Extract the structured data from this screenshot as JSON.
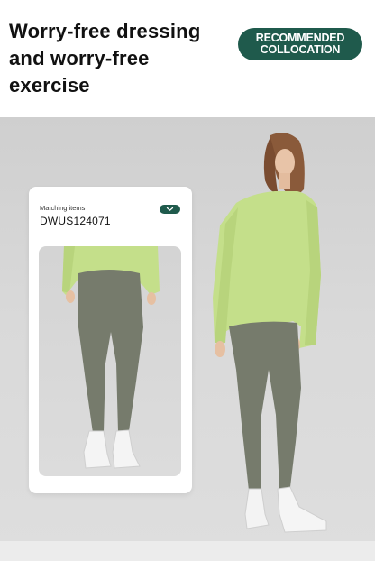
{
  "header": {
    "headline_line1": "Worry-free dressing",
    "headline_line2": "and worry-free",
    "headline_line3": "exercise",
    "badge_line1": "RECOMMENDED",
    "badge_line2": "COLLOCATION"
  },
  "card": {
    "label": "Matching items",
    "code": "DWUS124071",
    "toggle_icon": "chevron-down-icon"
  },
  "colors": {
    "brand": "#1f5a4c",
    "top_green": "#c4df8a",
    "leggings": "#767b6c"
  }
}
